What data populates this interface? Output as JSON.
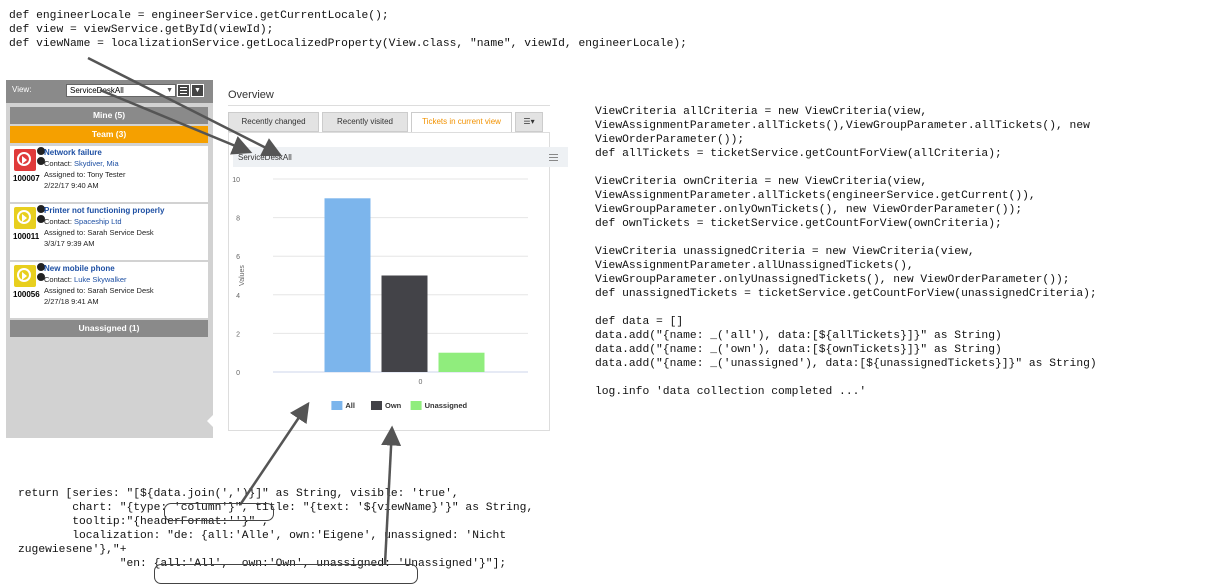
{
  "code_top": [
    "def engineerLocale = engineerService.getCurrentLocale();",
    "def view = viewService.getById(viewId);",
    "def viewName = localizationService.getLocalizedProperty(View.class, \"name\", viewId, engineerLocale);"
  ],
  "code_right": [
    "ViewCriteria allCriteria = new ViewCriteria(view,",
    "ViewAssignmentParameter.allTickets(),ViewGroupParameter.allTickets(), new",
    "ViewOrderParameter());",
    "def allTickets = ticketService.getCountForView(allCriteria);",
    "",
    "ViewCriteria ownCriteria = new ViewCriteria(view,",
    "ViewAssignmentParameter.allTickets(engineerService.getCurrent()),",
    "ViewGroupParameter.onlyOwnTickets(), new ViewOrderParameter());",
    "def ownTickets = ticketService.getCountForView(ownCriteria);",
    "",
    "ViewCriteria unassignedCriteria = new ViewCriteria(view,",
    "ViewAssignmentParameter.allUnassignedTickets(),",
    "ViewGroupParameter.onlyUnassignedTickets(), new ViewOrderParameter());",
    "def unassignedTickets = ticketService.getCountForView(unassignedCriteria);",
    "",
    "def data = []",
    "data.add(\"{name: _('all'), data:[${allTickets}]}\" as String)",
    "data.add(\"{name: _('own'), data:[${ownTickets}]}\" as String)",
    "data.add(\"{name: _('unassigned'), data:[${unassignedTickets}]}\" as String)",
    "",
    "log.info 'data collection completed ...'"
  ],
  "code_bottom": [
    "return [series: \"[${data.join(',')}]\" as String, visible: 'true',",
    "        chart: \"{type: 'column'}\", title: \"{text: '${viewName}'}\" as String,",
    "        tooltip:\"{headerFormat:''}\" ,",
    "        localization: \"de: {all:'Alle', own:'Eigene', unassigned: 'Nicht",
    "zugewiesene'},\"+",
    "               \"en: {all:'All',  own:'Own', unassigned: 'Unassigned'}\"];"
  ],
  "left_panel": {
    "view_label": "View:",
    "view_value": "ServiceDeskAll",
    "mine_header": "Mine (5)",
    "team_header": "Team (3)",
    "unassigned_header": "Unassigned (1)",
    "tickets": [
      {
        "id": "100007",
        "title": "Network failure",
        "contact_label": "Contact:",
        "contact": "Skydiver, Mia",
        "assigned": "Assigned to: Tony Tester",
        "date": "2/22/17 9:40 AM",
        "color": "#e03a3a"
      },
      {
        "id": "100011",
        "title": "Printer not functioning properly",
        "contact_label": "Contact:",
        "contact": "Spaceship Ltd",
        "assigned": "Assigned to: Sarah Service Desk",
        "date": "3/3/17 9:39 AM",
        "color": "#e8cf1e"
      },
      {
        "id": "100056",
        "title": "New mobile phone",
        "contact_label": "Contact:",
        "contact": "Luke Skywalker",
        "assigned": "Assigned to: Sarah Service Desk",
        "date": "2/27/18 9:41 AM",
        "color": "#e8cf1e"
      }
    ]
  },
  "overview": {
    "title": "Overview",
    "tabs": [
      "Recently changed",
      "Recently visited",
      "Tickets in current view"
    ],
    "active_tab": "Tickets in current view",
    "chart_title": "ServiceDeskAll"
  },
  "chart_data": {
    "type": "bar",
    "title": "ServiceDeskAll",
    "categories": [
      "0"
    ],
    "ylabel": "Values",
    "ylim": [
      0,
      10
    ],
    "yticks": [
      0,
      2,
      4,
      6,
      8,
      10
    ],
    "legend": "bottom",
    "series": [
      {
        "name": "All",
        "values": [
          9
        ],
        "color": "#7cb5ec"
      },
      {
        "name": "Own",
        "values": [
          5
        ],
        "color": "#434348"
      },
      {
        "name": "Unassigned",
        "values": [
          1
        ],
        "color": "#90ed7d"
      }
    ]
  }
}
